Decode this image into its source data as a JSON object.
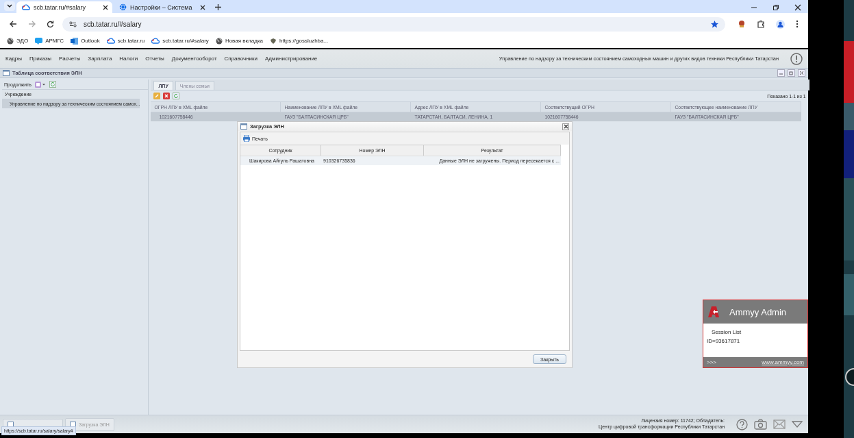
{
  "browser": {
    "tabs": [
      {
        "title": "scb.tatar.ru/#salary",
        "selected": true
      },
      {
        "title": "Настройки – Система",
        "selected": false
      }
    ],
    "address": "scb.tatar.ru/#salary",
    "bookmarks": [
      {
        "label": "ЭДО",
        "kind": "globe"
      },
      {
        "label": "АРМГС",
        "kind": "chat"
      },
      {
        "label": "Outlook",
        "kind": "outlook"
      },
      {
        "label": "scb.tatar.ru",
        "kind": "cloud"
      },
      {
        "label": "scb.tatar.ru/#salary",
        "kind": "cloud"
      },
      {
        "label": "Новая вкладка",
        "kind": "globe"
      },
      {
        "label": "https://gossluzhba...",
        "kind": "emblem"
      }
    ]
  },
  "app": {
    "menu": [
      "Кадры",
      "Приказы",
      "Расчеты",
      "Зарплата",
      "Налоги",
      "Отчеты",
      "Документооборот",
      "Справочники",
      "Администрирование"
    ],
    "organization": "Управление по надзору за техническим состоянием самоходных машин и других видов техники Республики Татарстан",
    "window_title": "Таблица соответствия ЭЛН",
    "left": {
      "toolbar_label": "Продолжить",
      "column": "Учреждение",
      "rows": [
        {
          "text": "Управление по надзору за техническим состоянием самох...",
          "selected": true
        }
      ]
    },
    "tabs": [
      {
        "label": "ЛПУ",
        "selected": true
      },
      {
        "label": "Члены семьи",
        "selected": false
      }
    ],
    "paging": "Показано 1-1 из 1",
    "columns": [
      "ОГРН ЛПУ в XML файле",
      "Наименование ЛПУ в XML файле",
      "Адрес ЛПУ в XML файле",
      "Соответствущий ОГРН",
      "Соответствующее наименование ЛПУ"
    ],
    "rows": [
      {
        "cells": [
          "1021607758446",
          "ГАУЗ \"БАЛТАСИНСКАЯ ЦРБ\"",
          "ТАТАРСТАН, БАЛТАСИ, ЛЕНИНА, 1",
          "1021607758446",
          "ГАУЗ \"БАЛТАСИНСКАЯ ЦРБ\""
        ],
        "selected": true
      }
    ],
    "dialog": {
      "title": "Загрузка ЭЛН",
      "print_label": "Печать",
      "columns": [
        "Сотрудник",
        "Номер ЭЛН",
        "Результат"
      ],
      "rows": [
        {
          "cells": [
            "Шакирова Айгуль Рашатовна",
            "910326735836",
            "Данные ЭЛН не загружены. Период пересекается с ..."
          ]
        }
      ],
      "close_label": "Закрыть"
    },
    "taskbar": [
      {
        "label": "Загрузка ЭЛН"
      }
    ],
    "license": [
      "Лицензия номер: 11742; Обладатель:",
      "Центр цифровой трансформации Республики Татарстан"
    ],
    "status_url": "https://scb.tatar.ru/salary/salary#"
  },
  "ammyy": {
    "title": "Ammyy Admin",
    "session": "Session List",
    "id": "ID=93617871",
    "more": ">>>",
    "link": "www.ammyy.com"
  }
}
